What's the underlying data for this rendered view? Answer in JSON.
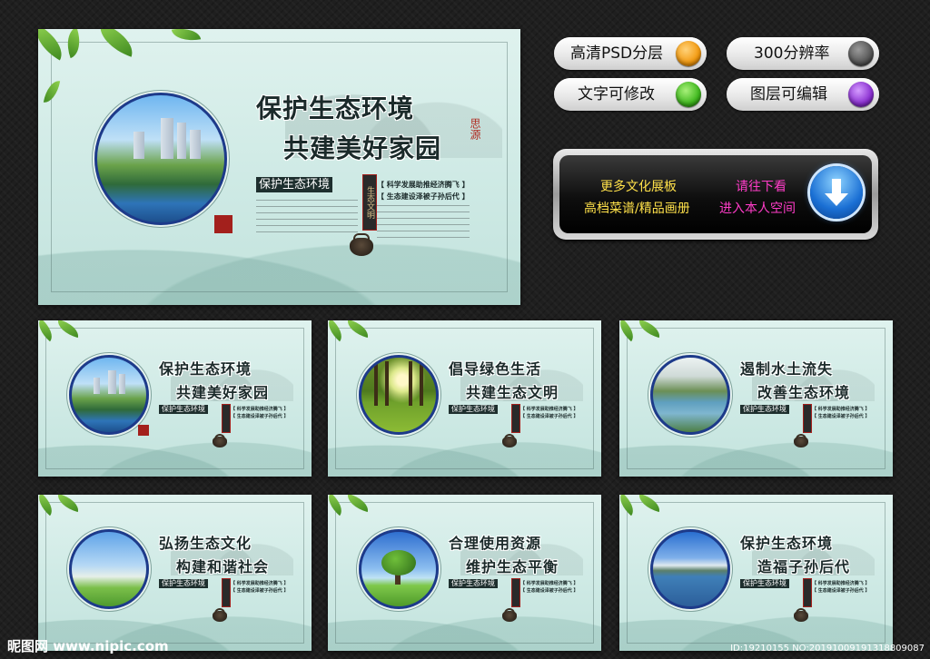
{
  "features": [
    {
      "label": "高清PSD分层",
      "color": "#f39a10"
    },
    {
      "label": "300分辨率",
      "color": "#555555"
    },
    {
      "label": "文字可修改",
      "color": "#3fb81e"
    },
    {
      "label": "图层可编辑",
      "color": "#8a2fd0"
    }
  ],
  "banner": {
    "line1_left": "更多文化展板",
    "line1_right": "请往下看",
    "line2_left": "高档菜谱/精品画册",
    "line2_right": "进入本人空间"
  },
  "main_board": {
    "title1": "保护生态环境",
    "title2": "共建美好家园",
    "subtitle": "保护生态环境",
    "slogan1": "【 科学发展助推经济腾飞 】",
    "slogan2": "【 生态建设泽被子孙后代 】",
    "vertical_seal": "生态文明",
    "red_mark": "思源"
  },
  "thumbs": [
    {
      "title1": "保护生态环境",
      "title2": "共建美好家园",
      "subtitle": "保护生态环境",
      "scene": "city"
    },
    {
      "title1": "倡导绿色生活",
      "title2": "共建生态文明",
      "subtitle": "保护生态环境",
      "scene": "forest"
    },
    {
      "title1": "遏制水土流失",
      "title2": "改善生态环境",
      "subtitle": "保护生态环境",
      "scene": "river"
    },
    {
      "title1": "弘扬生态文化",
      "title2": "构建和谐社会",
      "subtitle": "保护生态环境",
      "scene": "family"
    },
    {
      "title1": "合理使用资源",
      "title2": "维护生态平衡",
      "subtitle": "保护生态环境",
      "scene": "tree"
    },
    {
      "title1": "保护生态环境",
      "title2": "造福子孙后代",
      "subtitle": "保护生态环境",
      "scene": "lake"
    }
  ],
  "thumb_slogans": [
    "【 科学发展助推经济腾飞 】",
    "【 生态建设泽被子孙后代 】"
  ],
  "footer": {
    "logo": "昵图网 www.nipic.com",
    "id": "ID:19210155 NO:20191009191318809087"
  }
}
